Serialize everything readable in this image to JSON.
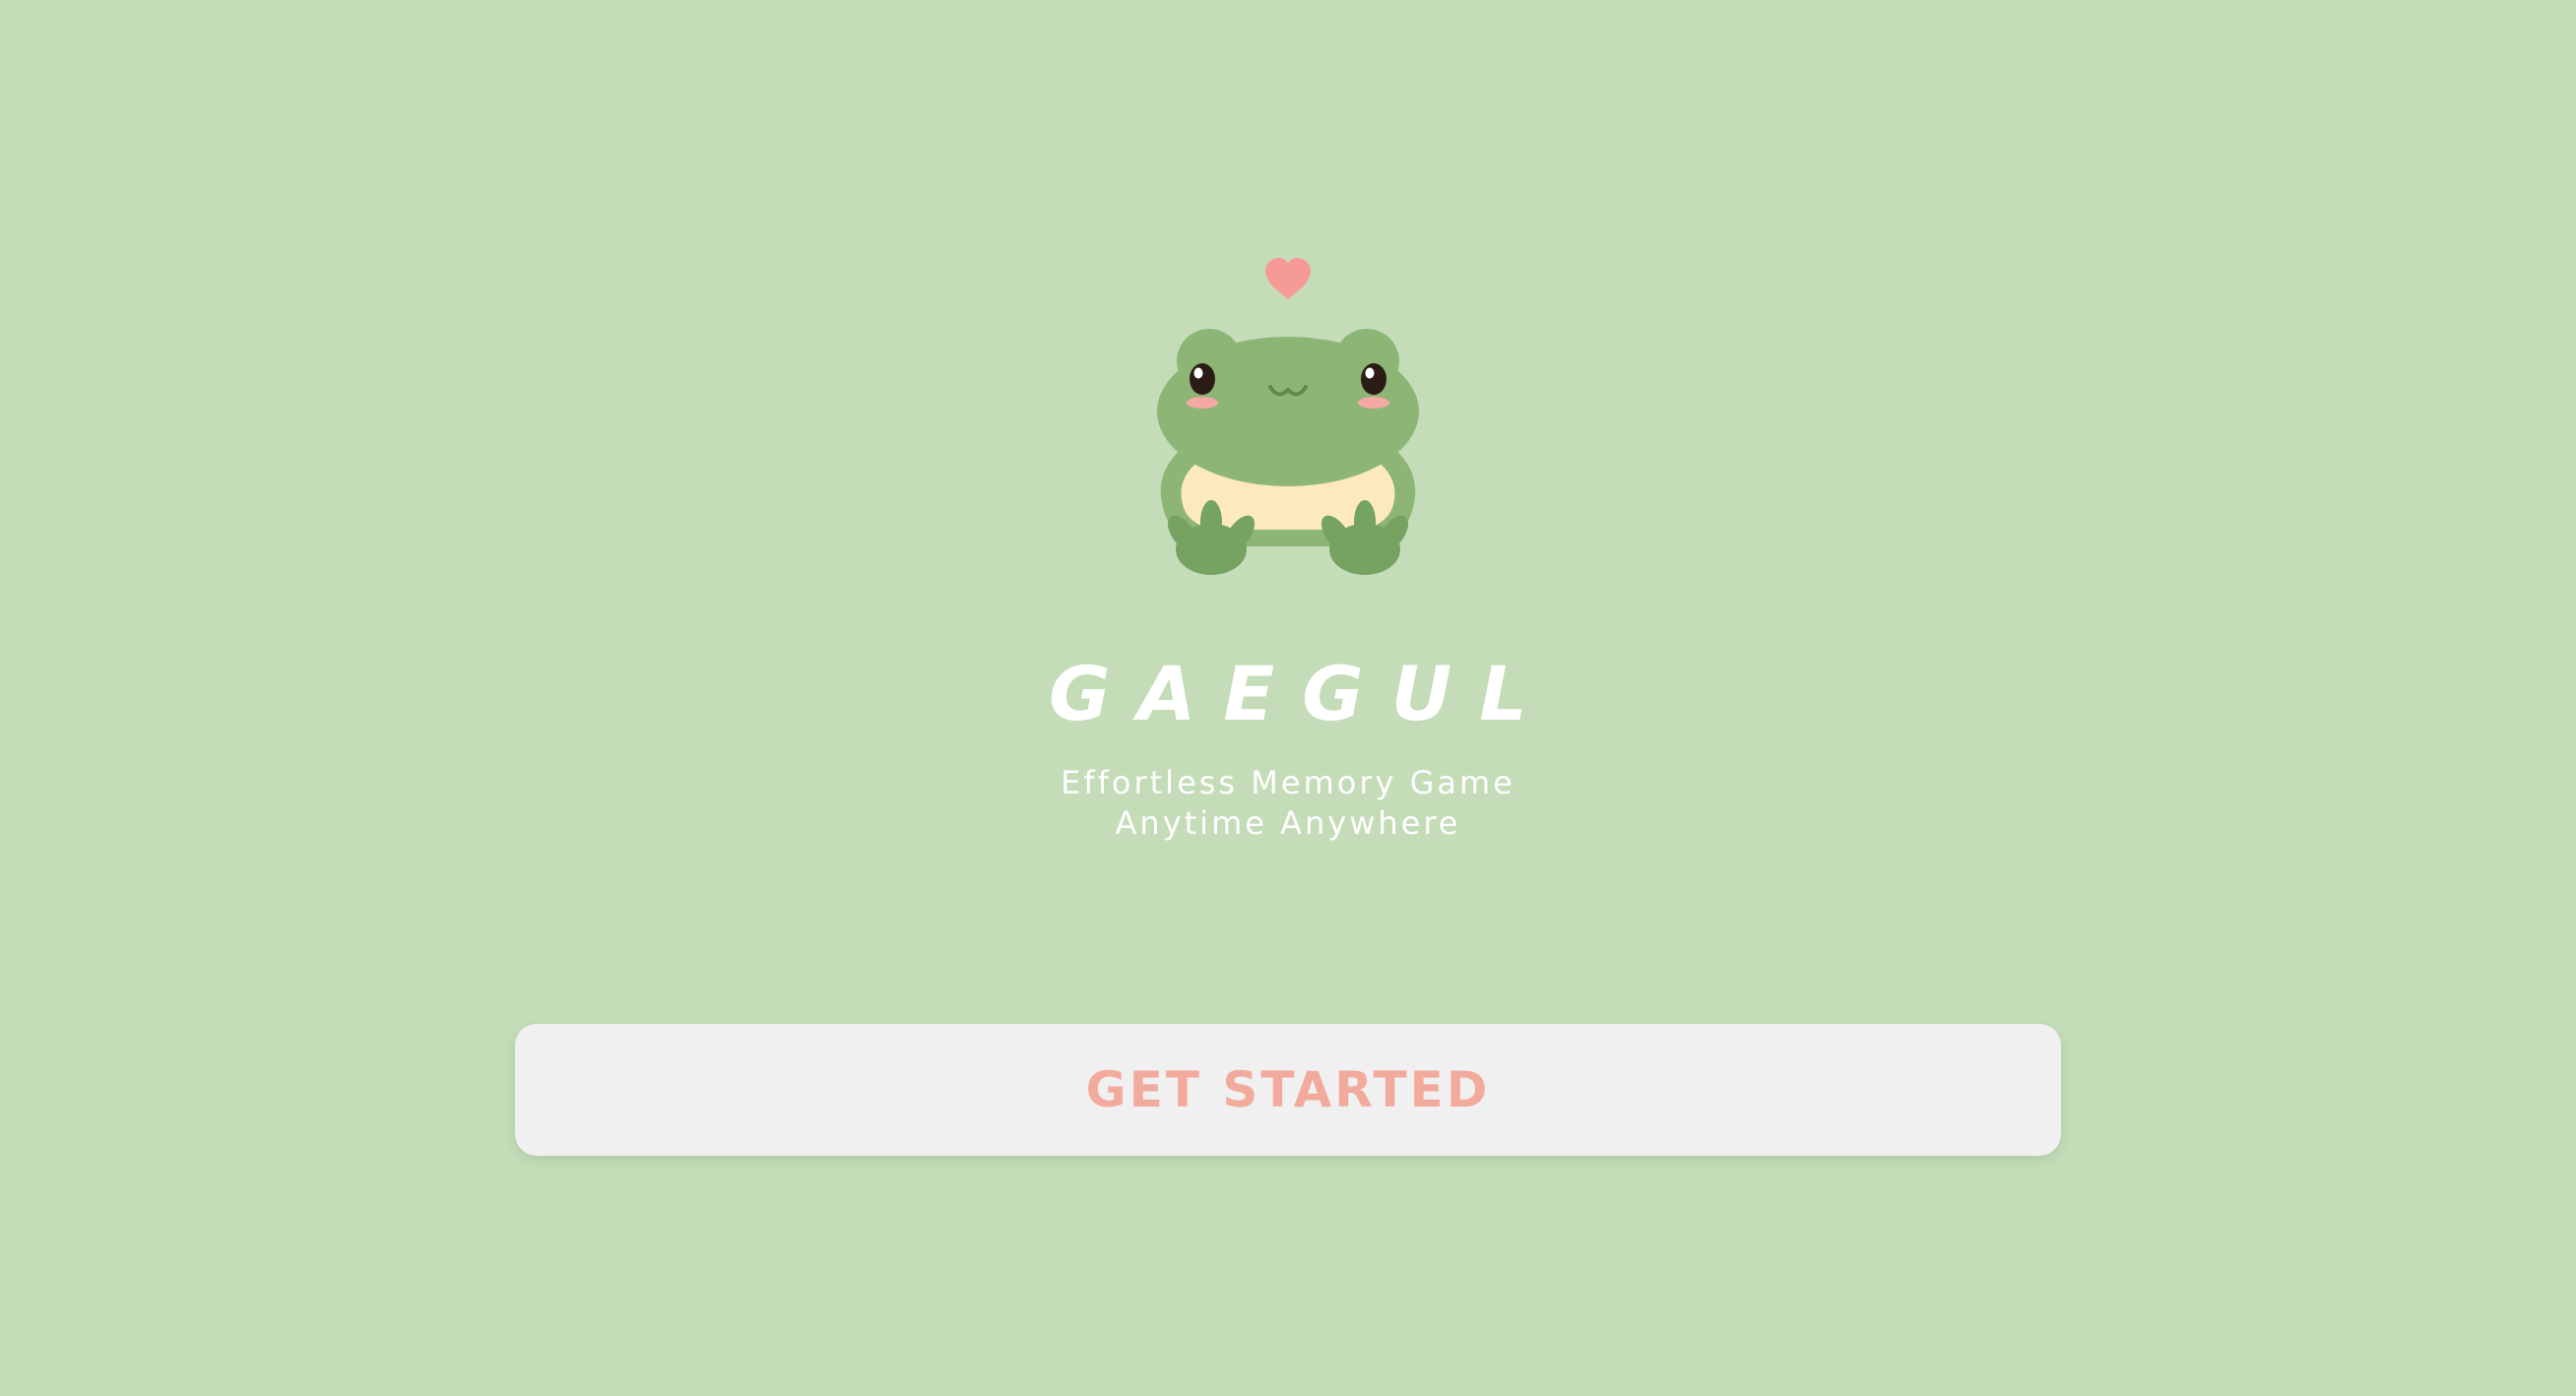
{
  "app": {
    "title": "GAEGUL",
    "tagline_line1": "Effortless Memory Game",
    "tagline_line2": "Anytime Anywhere"
  },
  "actions": {
    "get_started_label": "GET STARTED"
  },
  "mascot": {
    "icon": "frog-mascot-icon",
    "accent_icon": "heart-icon"
  },
  "colors": {
    "background": "#c4dcb8",
    "title_text": "#ffffff",
    "button_background": "#f0f0f0",
    "button_text": "#f2aa9c",
    "frog_green": "#8db576",
    "frog_dark_green": "#76a262",
    "frog_belly": "#fde9c0",
    "heart": "#f59a94"
  }
}
